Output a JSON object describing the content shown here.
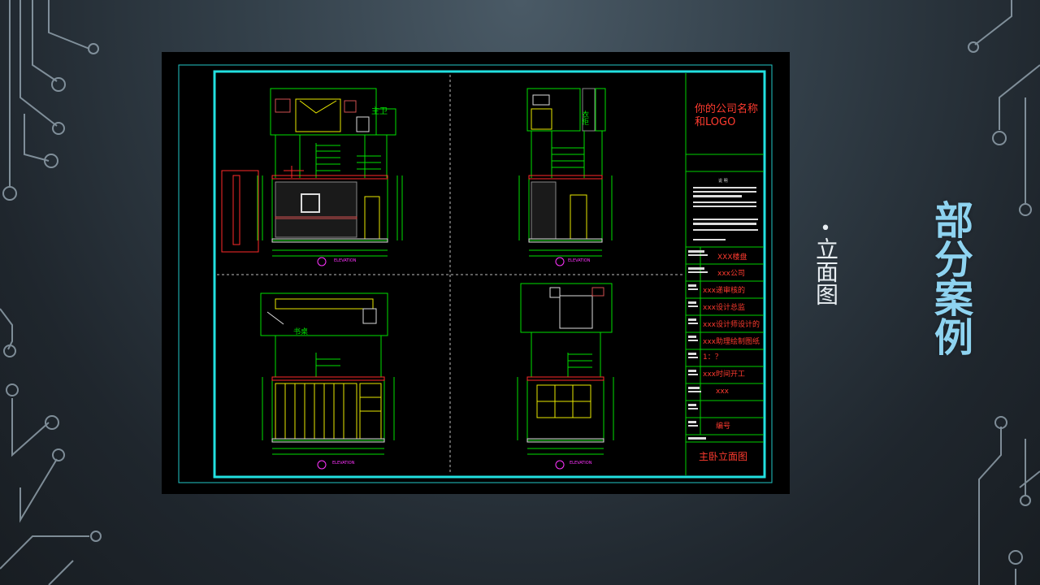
{
  "slide": {
    "title": "部分案例",
    "bullet": "•",
    "bullet_text": "立面图"
  },
  "drawing": {
    "company": {
      "line1": "你的公司名称",
      "line2": "和LOGO"
    },
    "notes": {
      "title": "说 明"
    },
    "rows": [
      {
        "value": "XXX楼盘"
      },
      {
        "value": "xxx公司"
      },
      {
        "value": "xxx递审核的"
      },
      {
        "value": "xxx设计总监"
      },
      {
        "value": "xxx设计师设计的"
      },
      {
        "value": "xxx助理绘制图纸"
      },
      {
        "value": "1：？"
      },
      {
        "value": "xxx时间开工"
      },
      {
        "value": "xxx"
      },
      {
        "value": ""
      },
      {
        "value": "编号"
      }
    ],
    "sheet_title": "主卧立面图",
    "room_labels": {
      "a": "主卫",
      "b": "衣柜",
      "c": "书桌"
    },
    "elevations": {
      "a": "ELEVATION",
      "b": "ELEVATION",
      "c": "ELEVATION",
      "d": "ELEVATION"
    },
    "colors": {
      "frame": "#22e0e0",
      "line": "#00ff00",
      "red": "#ff2a2a",
      "yellow": "#e8e800",
      "magenta": "#ff33ff"
    }
  }
}
